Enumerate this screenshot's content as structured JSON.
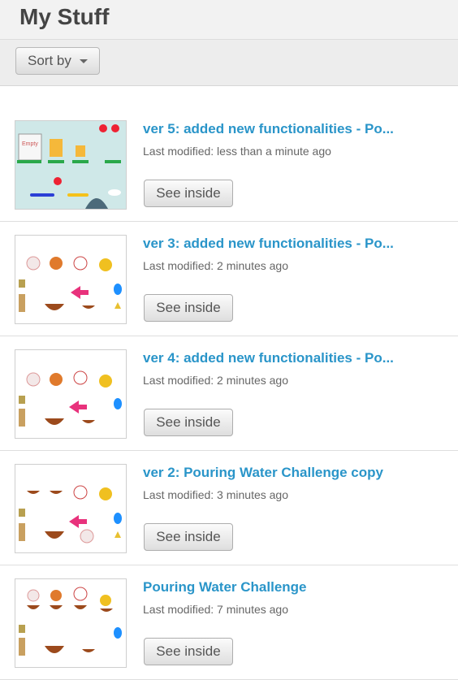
{
  "header": {
    "title": "My Stuff"
  },
  "toolbar": {
    "sort_label": "Sort by"
  },
  "projects": [
    {
      "title": "ver 5: added new functionalities - Po...",
      "modified": "Last modified: less than a minute ago",
      "button": "See inside"
    },
    {
      "title": "ver 3: added new functionalities - Po...",
      "modified": "Last modified: 2 minutes ago",
      "button": "See inside"
    },
    {
      "title": "ver 4: added new functionalities - Po...",
      "modified": "Last modified: 2 minutes ago",
      "button": "See inside"
    },
    {
      "title": "ver 2: Pouring Water Challenge copy",
      "modified": "Last modified: 3 minutes ago",
      "button": "See inside"
    },
    {
      "title": "Pouring Water Challenge",
      "modified": "Last modified: 7 minutes ago",
      "button": "See inside"
    }
  ],
  "thumbnail_labels": {
    "empty": "Empty"
  },
  "colors": {
    "link": "#2a95c9",
    "thumb_bg_teal": "#cfe8e8",
    "bowl": "#a0522d",
    "arrow": "#e8327c"
  }
}
